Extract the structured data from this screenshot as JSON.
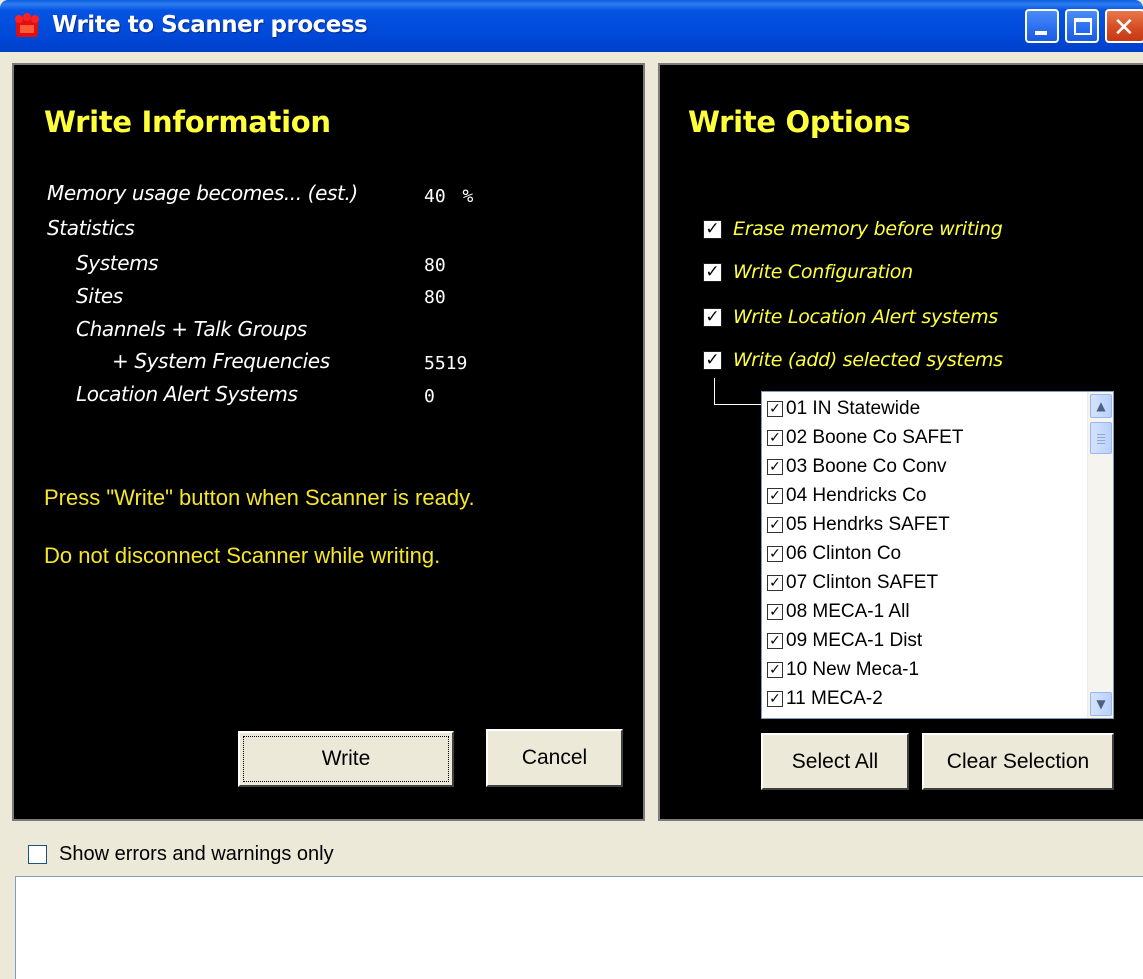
{
  "window": {
    "title": "Write to Scanner process"
  },
  "write_info": {
    "heading": "Write Information",
    "memory_label": "Memory usage becomes... (est.)",
    "memory_value": "40",
    "memory_unit": "%",
    "statistics_label": "Statistics",
    "stats": [
      {
        "label": "Systems",
        "value": "80"
      },
      {
        "label": "Sites",
        "value": "80"
      },
      {
        "label": "Channels + Talk Groups",
        "value": ""
      },
      {
        "label": "+ System Frequencies",
        "value": "5519"
      },
      {
        "label": "Location Alert Systems",
        "value": "0"
      }
    ],
    "message_ready": "Press \"Write\" button when Scanner is ready.",
    "message_warning": "Do not disconnect Scanner while writing.",
    "write_button": "Write",
    "cancel_button": "Cancel"
  },
  "write_options": {
    "heading": "Write Options",
    "options": [
      {
        "label": "Erase memory before writing",
        "checked": true
      },
      {
        "label": "Write Configuration",
        "checked": true
      },
      {
        "label": "Write Location Alert systems",
        "checked": true
      },
      {
        "label": "Write (add) selected systems",
        "checked": true
      }
    ],
    "systems": [
      {
        "label": "01 IN Statewide",
        "checked": true
      },
      {
        "label": "02 Boone Co SAFET",
        "checked": true
      },
      {
        "label": "03 Boone Co Conv",
        "checked": true
      },
      {
        "label": "04 Hendricks Co",
        "checked": true
      },
      {
        "label": "05 Hendrks SAFET",
        "checked": true
      },
      {
        "label": "06 Clinton Co",
        "checked": true
      },
      {
        "label": "07 Clinton SAFET",
        "checked": true
      },
      {
        "label": "08 MECA-1 All",
        "checked": true
      },
      {
        "label": "09 MECA-1 Dist",
        "checked": true
      },
      {
        "label": "10 New Meca-1",
        "checked": true
      },
      {
        "label": "11 MECA-2",
        "checked": true
      }
    ],
    "select_all_button": "Select All",
    "clear_selection_button": "Clear Selection"
  },
  "log": {
    "show_errors_label": "Show errors and warnings only",
    "show_errors_checked": false
  },
  "colors": {
    "panel_background": "#000000",
    "heading_yellow": "#ffff3c",
    "message_yellow": "#f5e628",
    "titlebar_blue": "#0048d8"
  }
}
